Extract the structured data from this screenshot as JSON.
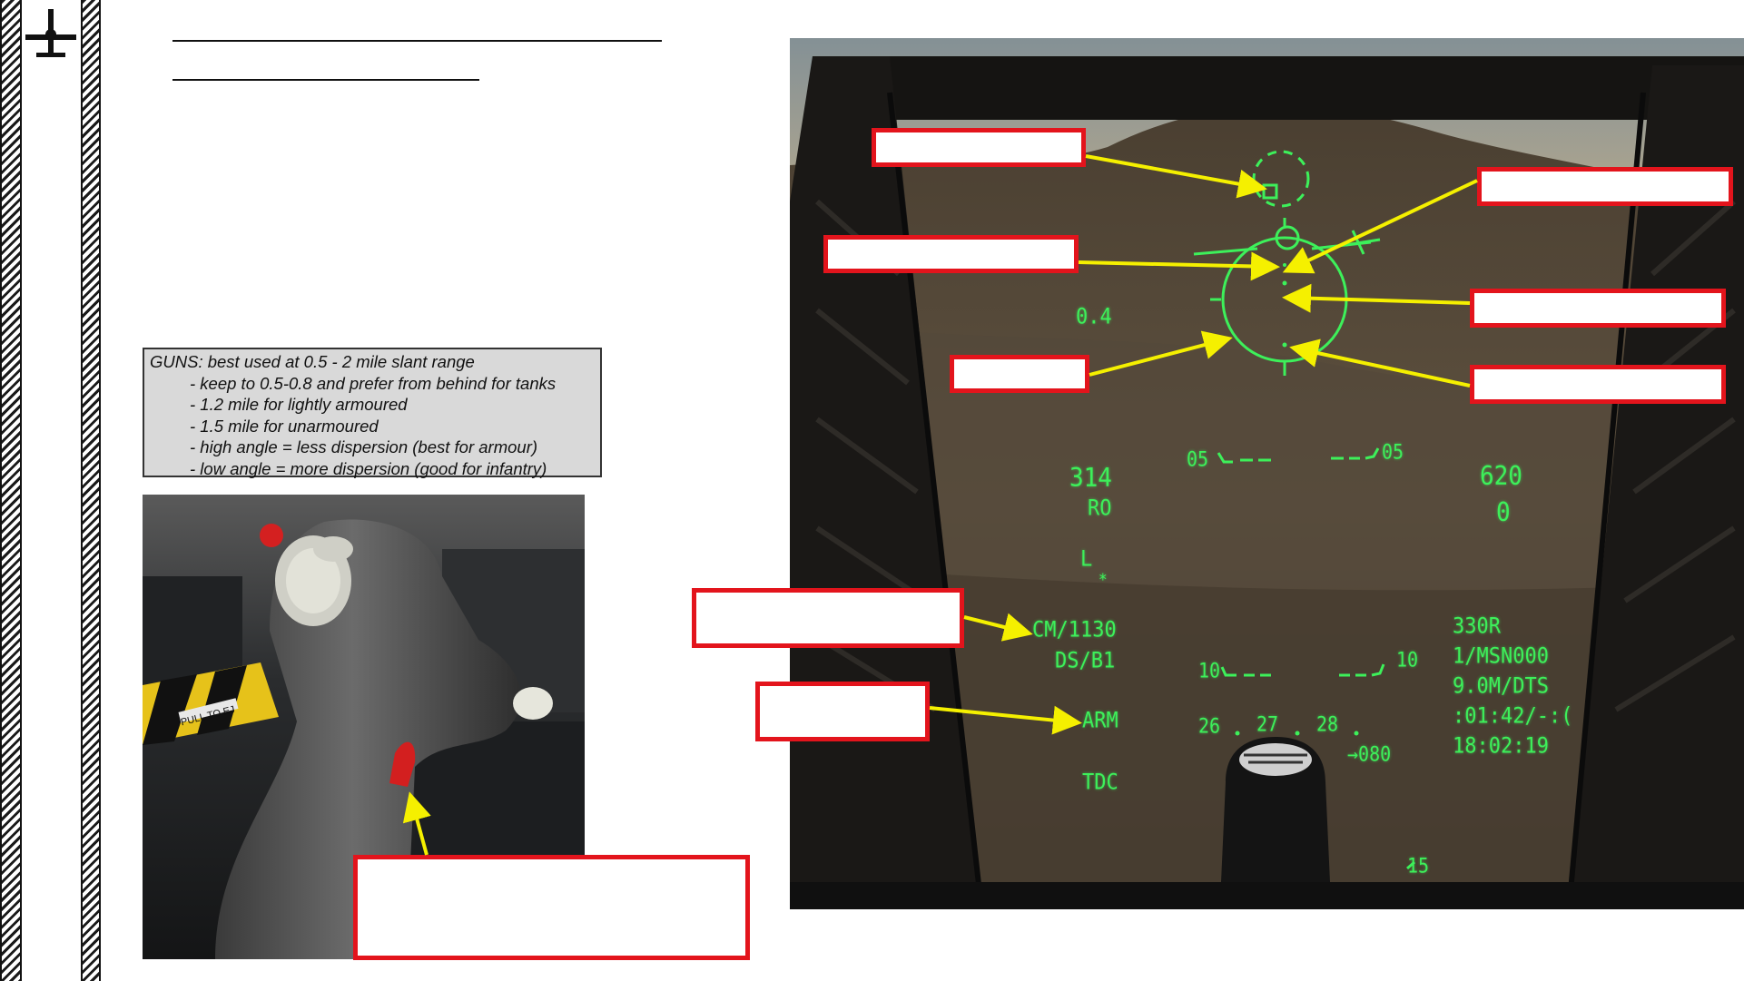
{
  "notes": {
    "title": "GUNS: best used at 0.5 - 2 mile slant range",
    "lines": [
      "- keep to 0.5-0.8 and prefer from behind for tanks",
      "- 1.2 mile for lightly armoured",
      "- 1.5 mile for unarmoured",
      "- high angle = less dispersion (best for armour)",
      "- low angle = more dispersion (good for infantry)"
    ]
  },
  "photo": {
    "placard": "PULL TO EJ"
  },
  "hud": {
    "range": "0.4",
    "heading": "314",
    "ro": "RO",
    "l": "L",
    "star": "*",
    "speed_top": "620",
    "speed_zero": "0",
    "pitch_05_left": "05",
    "pitch_05_right": "05",
    "pitch_10_left": "10",
    "pitch_10_right": "10",
    "pitch_15": "15",
    "cm": "CM/1130",
    "ds": "DS/B1",
    "arm": "ARM",
    "tdc": "TDC",
    "r330": "330R",
    "msn": "1/MSN000",
    "dts": "9.0M/DTS",
    "timer": ":01:42/-:(",
    "clock": "18:02:19",
    "heading_tape": [
      "26",
      "27",
      "28"
    ],
    "bearing": "→080"
  },
  "colors": {
    "hud_green": "#3df05a",
    "callout_red": "#e3141c",
    "arrow_yellow": "#f5f000"
  },
  "icons": {
    "logo": "aircraft-silhouette-icon"
  }
}
